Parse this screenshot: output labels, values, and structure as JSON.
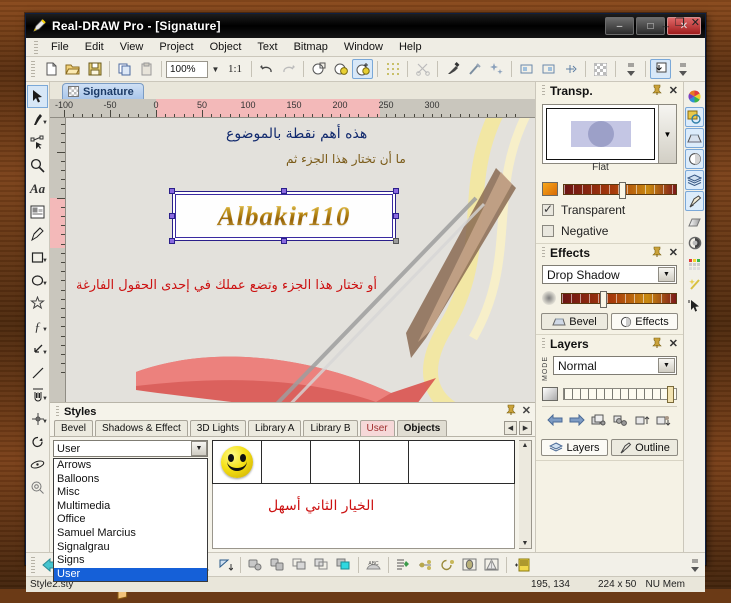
{
  "window": {
    "title": "Real-DRAW Pro - [Signature]",
    "minimize": "–",
    "maximize": "□",
    "close": "✕",
    "mdi_minimize": "_",
    "mdi_restore": "❐",
    "mdi_close": "✕"
  },
  "menu": [
    "File",
    "Edit",
    "View",
    "Project",
    "Object",
    "Text",
    "Bitmap",
    "Window",
    "Help"
  ],
  "toolbar": {
    "zoom_value": "100%",
    "ratio": "1:1",
    "icons": [
      "new-document-icon",
      "open-folder-icon",
      "save-disk-icon",
      "copy-icon",
      "paste-icon",
      "undo-icon",
      "redo-icon",
      "object-outline-icon",
      "object-fill-icon",
      "object-new-icon",
      "grid-icon",
      "scissors-icon",
      "eyedropper-icon",
      "magic-brush-icon",
      "sparkle-icon",
      "align-left-icon",
      "align-right-icon",
      "text-wrap-icon",
      "checker-icon",
      "bring-front-icon"
    ]
  },
  "left_tools": [
    {
      "name": "select-tool",
      "glyph": "➤",
      "selected": true,
      "caret": false
    },
    {
      "name": "brush-tool",
      "glyph": "✒",
      "selected": false,
      "caret": true
    },
    {
      "name": "node-edit-tool",
      "glyph": "⟋",
      "selected": false,
      "caret": false
    },
    {
      "name": "zoom-tool",
      "glyph": "🔍",
      "selected": false,
      "caret": false
    },
    {
      "name": "text-tool",
      "glyph": "Aa",
      "selected": false,
      "caret": false
    },
    {
      "name": "bitmap-tool",
      "glyph": "▦",
      "selected": false,
      "caret": false
    },
    {
      "name": "pen-tool",
      "glyph": "✎",
      "selected": false,
      "caret": false
    },
    {
      "name": "rectangle-tool",
      "glyph": "▭",
      "selected": false,
      "caret": true
    },
    {
      "name": "ellipse-tool",
      "glyph": "○",
      "selected": false,
      "caret": true
    },
    {
      "name": "star-tool",
      "glyph": "✳",
      "selected": false,
      "caret": false
    },
    {
      "name": "curve-tool",
      "glyph": "ƒ",
      "selected": false,
      "caret": true
    },
    {
      "name": "arrow-shape-tool",
      "glyph": "↙",
      "selected": false,
      "caret": true
    },
    {
      "name": "line-tool",
      "glyph": "╱",
      "selected": false,
      "caret": false
    },
    {
      "name": "hand-tool",
      "glyph": "✋",
      "selected": false,
      "caret": true
    },
    {
      "name": "crosshair-tool",
      "glyph": "✛",
      "selected": false,
      "caret": true
    },
    {
      "name": "rotate-tool",
      "glyph": "↻",
      "selected": false,
      "caret": false
    },
    {
      "name": "perspective-tool",
      "glyph": "◈",
      "selected": false,
      "caret": false
    },
    {
      "name": "magnifier-tool",
      "glyph": "◎",
      "selected": false,
      "caret": false
    }
  ],
  "right_tools": [
    {
      "name": "color-wheel-icon",
      "on": false
    },
    {
      "name": "object-style-icon",
      "on": true
    },
    {
      "name": "bevel-icon",
      "on": true
    },
    {
      "name": "effects-icon",
      "on": true
    },
    {
      "name": "layers-icon",
      "on": true
    },
    {
      "name": "outline-icon",
      "on": true
    },
    {
      "name": "gradient-icon",
      "on": false
    },
    {
      "name": "transparency-icon",
      "on": false
    },
    {
      "name": "palette-grid-icon",
      "on": false
    },
    {
      "name": "magic-wand-icon",
      "on": false
    },
    {
      "name": "pointer-icon",
      "on": false
    }
  ],
  "document": {
    "tab_label": "Signature",
    "tab_icon": "checker-thumbnail-icon"
  },
  "ruler": {
    "h_labels": [
      "-100",
      "-50",
      "0",
      "50",
      "100",
      "150",
      "200",
      "250",
      "300"
    ],
    "v_labels": []
  },
  "canvas": {
    "annotation_top": "هذه أهم نقطة بالموضوع",
    "annotation_right": "ما أن تختار هذا الجزء ثم",
    "annotation_bottom": "أو تختار هذا الجزء وتضع عملك في إحدى الحقول الفارغة",
    "logo_text": "Albakir110"
  },
  "styles_panel": {
    "title": "Styles",
    "pin": "📌",
    "close": "✕",
    "tabs": [
      {
        "label": "Bevel",
        "state": "normal"
      },
      {
        "label": "Shadows & Effect",
        "state": "normal"
      },
      {
        "label": "3D Lights",
        "state": "normal"
      },
      {
        "label": "Library A",
        "state": "normal"
      },
      {
        "label": "Library B",
        "state": "normal"
      },
      {
        "label": "User",
        "state": "user"
      },
      {
        "label": "Objects",
        "state": "active"
      }
    ],
    "nav_prev": "◀",
    "nav_next": "▶",
    "combo_value": "User",
    "dropdown_items": [
      {
        "label": "Arrows",
        "selected": false
      },
      {
        "label": "Balloons",
        "selected": false
      },
      {
        "label": "Misc",
        "selected": false
      },
      {
        "label": "Multimedia",
        "selected": false
      },
      {
        "label": "Office",
        "selected": false
      },
      {
        "label": "Samuel Marcius",
        "selected": false
      },
      {
        "label": "Signalgrau",
        "selected": false
      },
      {
        "label": "Signs",
        "selected": false
      },
      {
        "label": "User",
        "selected": true
      }
    ],
    "grid_cells": [
      "smiley-face-thumbnail",
      "",
      "",
      "",
      ""
    ],
    "note_text": "الخيار الثاني أسهل"
  },
  "transp_panel": {
    "title": "Transp.",
    "pin": "📌",
    "close": "✕",
    "preview_label": "Flat",
    "dropdown_arrow": "▼",
    "transparent_label": "Transparent",
    "transparent_checked": true,
    "negative_label": "Negative",
    "negative_checked": false
  },
  "effects_panel": {
    "title": "Effects",
    "pin": "📌",
    "close": "✕",
    "effect_value": "Drop Shadow",
    "dropdown_arrow": "▼",
    "tab_bevel": "Bevel",
    "tab_effects": "Effects"
  },
  "layers_panel": {
    "title": "Layers",
    "pin": "📌",
    "close": "✕",
    "mode_label": "MODE",
    "mode_value": "Normal",
    "dropdown_arrow": "▼",
    "buttons": [
      "move-left-icon",
      "move-right-icon",
      "duplicate-layer-icon",
      "merge-layer-icon",
      "layer-up-icon",
      "layer-down-icon"
    ],
    "tab_layers": "Layers",
    "tab_outline": "Outline"
  },
  "bottom_toolbar": {
    "icons": [
      "back-arrow-icon",
      "align-distribute-icon",
      "align-top-icon",
      "align-bottom-icon",
      "center-icon",
      "circle-select-icon",
      "flip-horizontal-icon",
      "flip-vertical-icon",
      "group-icon",
      "ungroup-icon",
      "combine-icon",
      "break-icon",
      "object-front-icon",
      "text-abc-icon",
      "list-properties-icon",
      "node-edit-icon",
      "rotate-object-icon",
      "shape-icon",
      "gradient-mesh-icon",
      "add-style-icon"
    ]
  },
  "statusbar": {
    "file": "Style2.sty",
    "coords": "195, 134",
    "size": "224 x 50",
    "memory": "NU Mem"
  },
  "colors": {
    "accent_blue": "#1560d8",
    "user_tab": "#f6d8d8",
    "gold": "#d8a520",
    "red_note": "#cc1111",
    "frame_wood": "#6b3a16"
  }
}
